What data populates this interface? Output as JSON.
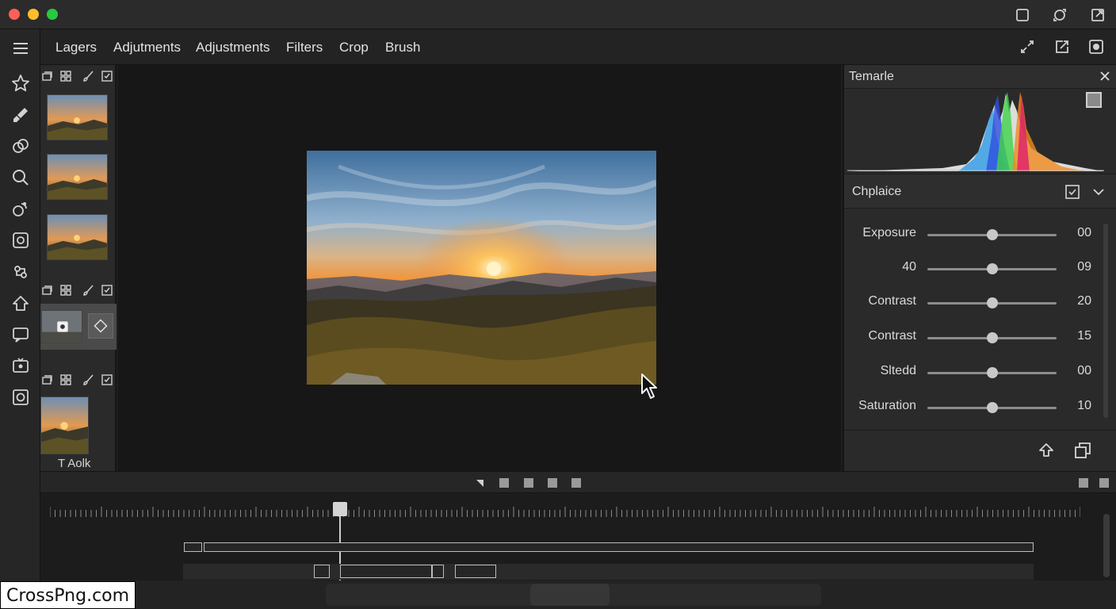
{
  "window": {
    "title_icons": [
      "window-icon",
      "sync-icon",
      "export-icon"
    ]
  },
  "toolrail": {
    "tools": [
      "menu-icon",
      "star-icon",
      "brush-icon",
      "heal-icon",
      "zoom-icon",
      "clone-icon",
      "camera-icon",
      "transform-icon",
      "shape-icon",
      "comment-icon",
      "media-icon",
      "capture-icon"
    ]
  },
  "menubar": {
    "items": [
      "Lagers",
      "Adjutments",
      "Adjustments",
      "Filters",
      "Crop",
      "Brush"
    ],
    "right_icons": [
      "expand-icon",
      "share-icon",
      "settings-icon"
    ]
  },
  "layers": {
    "active_label": "T Aolk"
  },
  "right_panel": {
    "title": "Temarle",
    "section_title": "Chplaice",
    "adjustments": [
      {
        "label": "Exposure",
        "value": "00",
        "level": 0.5
      },
      {
        "label": "40",
        "value": "09",
        "level": 0.5
      },
      {
        "label": "Contrast",
        "value": "20",
        "level": 0.5
      },
      {
        "label": "Contrast",
        "value": "15",
        "level": 0.5
      },
      {
        "label": "Sltedd",
        "value": "00",
        "level": 0.5
      },
      {
        "label": "Saturation",
        "value": "10",
        "level": 0.5
      }
    ]
  },
  "timeline": {
    "playhead_position": 0.28
  },
  "watermark": {
    "text": "CrossPng.com"
  },
  "colors": {
    "accent": "#d4d4d4",
    "background": "#1e1e1e",
    "panel": "#2a2a2a"
  }
}
